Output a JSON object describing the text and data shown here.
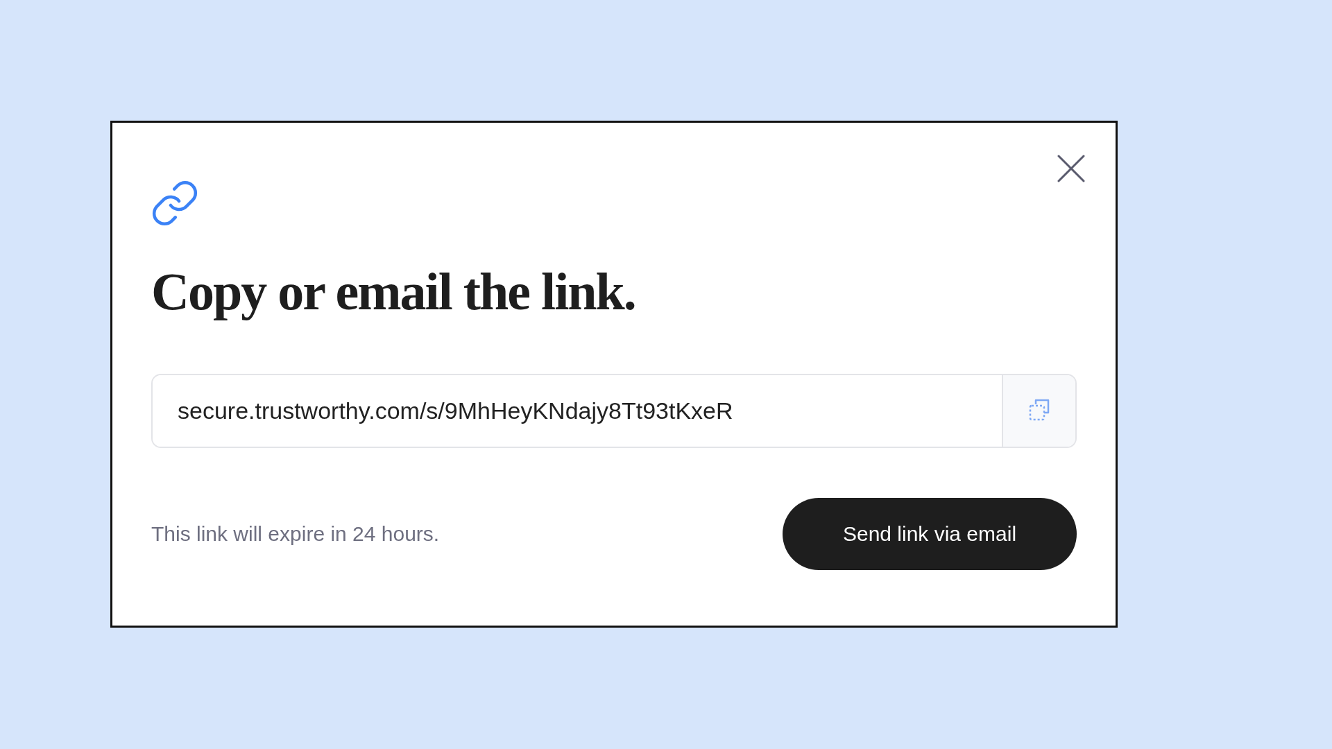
{
  "dialog": {
    "title": "Copy or email the link.",
    "link_field": {
      "value": "secure.trustworthy.com/s/9MhHeyKNdajy8Tt93tKxeR"
    },
    "expiry_note": "This link will expire in 24 hours.",
    "send_button": "Send link via email"
  }
}
